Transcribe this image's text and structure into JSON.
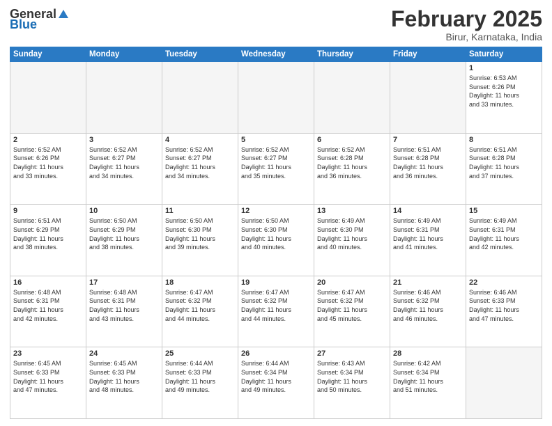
{
  "header": {
    "logo_general": "General",
    "logo_blue": "Blue",
    "title": "February 2025",
    "subtitle": "Birur, Karnataka, India"
  },
  "weekdays": [
    "Sunday",
    "Monday",
    "Tuesday",
    "Wednesday",
    "Thursday",
    "Friday",
    "Saturday"
  ],
  "weeks": [
    [
      {
        "day": "",
        "empty": true
      },
      {
        "day": "",
        "empty": true
      },
      {
        "day": "",
        "empty": true
      },
      {
        "day": "",
        "empty": true
      },
      {
        "day": "",
        "empty": true
      },
      {
        "day": "",
        "empty": true
      },
      {
        "day": "1",
        "sunrise": "Sunrise: 6:53 AM",
        "sunset": "Sunset: 6:26 PM",
        "daylight": "Daylight: 11 hours and 33 minutes."
      }
    ],
    [
      {
        "day": "2",
        "sunrise": "Sunrise: 6:52 AM",
        "sunset": "Sunset: 6:26 PM",
        "daylight": "Daylight: 11 hours and 33 minutes."
      },
      {
        "day": "3",
        "sunrise": "Sunrise: 6:52 AM",
        "sunset": "Sunset: 6:27 PM",
        "daylight": "Daylight: 11 hours and 34 minutes."
      },
      {
        "day": "4",
        "sunrise": "Sunrise: 6:52 AM",
        "sunset": "Sunset: 6:27 PM",
        "daylight": "Daylight: 11 hours and 34 minutes."
      },
      {
        "day": "5",
        "sunrise": "Sunrise: 6:52 AM",
        "sunset": "Sunset: 6:27 PM",
        "daylight": "Daylight: 11 hours and 35 minutes."
      },
      {
        "day": "6",
        "sunrise": "Sunrise: 6:52 AM",
        "sunset": "Sunset: 6:28 PM",
        "daylight": "Daylight: 11 hours and 36 minutes."
      },
      {
        "day": "7",
        "sunrise": "Sunrise: 6:51 AM",
        "sunset": "Sunset: 6:28 PM",
        "daylight": "Daylight: 11 hours and 36 minutes."
      },
      {
        "day": "8",
        "sunrise": "Sunrise: 6:51 AM",
        "sunset": "Sunset: 6:28 PM",
        "daylight": "Daylight: 11 hours and 37 minutes."
      }
    ],
    [
      {
        "day": "9",
        "sunrise": "Sunrise: 6:51 AM",
        "sunset": "Sunset: 6:29 PM",
        "daylight": "Daylight: 11 hours and 38 minutes."
      },
      {
        "day": "10",
        "sunrise": "Sunrise: 6:50 AM",
        "sunset": "Sunset: 6:29 PM",
        "daylight": "Daylight: 11 hours and 38 minutes."
      },
      {
        "day": "11",
        "sunrise": "Sunrise: 6:50 AM",
        "sunset": "Sunset: 6:30 PM",
        "daylight": "Daylight: 11 hours and 39 minutes."
      },
      {
        "day": "12",
        "sunrise": "Sunrise: 6:50 AM",
        "sunset": "Sunset: 6:30 PM",
        "daylight": "Daylight: 11 hours and 40 minutes."
      },
      {
        "day": "13",
        "sunrise": "Sunrise: 6:49 AM",
        "sunset": "Sunset: 6:30 PM",
        "daylight": "Daylight: 11 hours and 40 minutes."
      },
      {
        "day": "14",
        "sunrise": "Sunrise: 6:49 AM",
        "sunset": "Sunset: 6:31 PM",
        "daylight": "Daylight: 11 hours and 41 minutes."
      },
      {
        "day": "15",
        "sunrise": "Sunrise: 6:49 AM",
        "sunset": "Sunset: 6:31 PM",
        "daylight": "Daylight: 11 hours and 42 minutes."
      }
    ],
    [
      {
        "day": "16",
        "sunrise": "Sunrise: 6:48 AM",
        "sunset": "Sunset: 6:31 PM",
        "daylight": "Daylight: 11 hours and 42 minutes."
      },
      {
        "day": "17",
        "sunrise": "Sunrise: 6:48 AM",
        "sunset": "Sunset: 6:31 PM",
        "daylight": "Daylight: 11 hours and 43 minutes."
      },
      {
        "day": "18",
        "sunrise": "Sunrise: 6:47 AM",
        "sunset": "Sunset: 6:32 PM",
        "daylight": "Daylight: 11 hours and 44 minutes."
      },
      {
        "day": "19",
        "sunrise": "Sunrise: 6:47 AM",
        "sunset": "Sunset: 6:32 PM",
        "daylight": "Daylight: 11 hours and 44 minutes."
      },
      {
        "day": "20",
        "sunrise": "Sunrise: 6:47 AM",
        "sunset": "Sunset: 6:32 PM",
        "daylight": "Daylight: 11 hours and 45 minutes."
      },
      {
        "day": "21",
        "sunrise": "Sunrise: 6:46 AM",
        "sunset": "Sunset: 6:32 PM",
        "daylight": "Daylight: 11 hours and 46 minutes."
      },
      {
        "day": "22",
        "sunrise": "Sunrise: 6:46 AM",
        "sunset": "Sunset: 6:33 PM",
        "daylight": "Daylight: 11 hours and 47 minutes."
      }
    ],
    [
      {
        "day": "23",
        "sunrise": "Sunrise: 6:45 AM",
        "sunset": "Sunset: 6:33 PM",
        "daylight": "Daylight: 11 hours and 47 minutes."
      },
      {
        "day": "24",
        "sunrise": "Sunrise: 6:45 AM",
        "sunset": "Sunset: 6:33 PM",
        "daylight": "Daylight: 11 hours and 48 minutes."
      },
      {
        "day": "25",
        "sunrise": "Sunrise: 6:44 AM",
        "sunset": "Sunset: 6:33 PM",
        "daylight": "Daylight: 11 hours and 49 minutes."
      },
      {
        "day": "26",
        "sunrise": "Sunrise: 6:44 AM",
        "sunset": "Sunset: 6:34 PM",
        "daylight": "Daylight: 11 hours and 49 minutes."
      },
      {
        "day": "27",
        "sunrise": "Sunrise: 6:43 AM",
        "sunset": "Sunset: 6:34 PM",
        "daylight": "Daylight: 11 hours and 50 minutes."
      },
      {
        "day": "28",
        "sunrise": "Sunrise: 6:42 AM",
        "sunset": "Sunset: 6:34 PM",
        "daylight": "Daylight: 11 hours and 51 minutes."
      },
      {
        "day": "",
        "empty": true
      }
    ]
  ]
}
